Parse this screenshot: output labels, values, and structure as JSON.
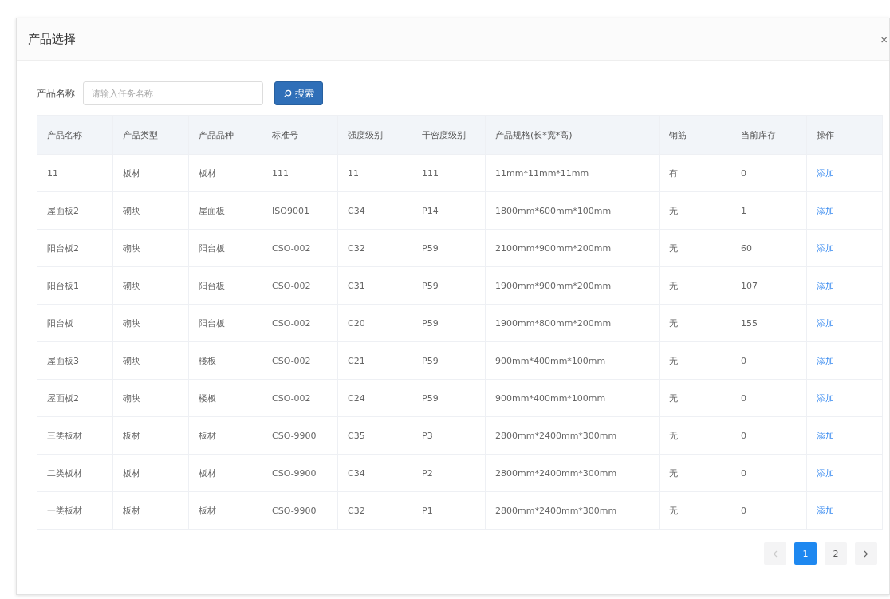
{
  "dialog": {
    "title": "产品选择",
    "close": "×"
  },
  "search": {
    "label": "产品名称",
    "placeholder": "请输入任务名称",
    "button": "搜索"
  },
  "table": {
    "columns": [
      "产品名称",
      "产品类型",
      "产品品种",
      "标准号",
      "强度级别",
      "干密度级别",
      "产品规格(长*宽*高)",
      "钢筋",
      "当前库存",
      "操作"
    ],
    "rows": [
      {
        "cells": [
          "11",
          "板材",
          "板材",
          "111",
          "11",
          "111",
          "11mm*11mm*11mm",
          "有",
          "0"
        ],
        "action": "添加"
      },
      {
        "cells": [
          "屋面板2",
          "砌块",
          "屋面板",
          "ISO9001",
          "C34",
          "P14",
          "1800mm*600mm*100mm",
          "无",
          "1"
        ],
        "action": "添加"
      },
      {
        "cells": [
          "阳台板2",
          "砌块",
          "阳台板",
          "CSO-002",
          "C32",
          "P59",
          "2100mm*900mm*200mm",
          "无",
          "60"
        ],
        "action": "添加"
      },
      {
        "cells": [
          "阳台板1",
          "砌块",
          "阳台板",
          "CSO-002",
          "C31",
          "P59",
          "1900mm*900mm*200mm",
          "无",
          "107"
        ],
        "action": "添加"
      },
      {
        "cells": [
          "阳台板",
          "砌块",
          "阳台板",
          "CSO-002",
          "C20",
          "P59",
          "1900mm*800mm*200mm",
          "无",
          "155"
        ],
        "action": "添加"
      },
      {
        "cells": [
          "屋面板3",
          "砌块",
          "楼板",
          "CSO-002",
          "C21",
          "P59",
          "900mm*400mm*100mm",
          "无",
          "0"
        ],
        "action": "添加"
      },
      {
        "cells": [
          "屋面板2",
          "砌块",
          "楼板",
          "CSO-002",
          "C24",
          "P59",
          "900mm*400mm*100mm",
          "无",
          "0"
        ],
        "action": "添加"
      },
      {
        "cells": [
          "三类板材",
          "板材",
          "板材",
          "CSO-9900",
          "C35",
          "P3",
          "2800mm*2400mm*300mm",
          "无",
          "0"
        ],
        "action": "添加"
      },
      {
        "cells": [
          "二类板材",
          "板材",
          "板材",
          "CSO-9900",
          "C34",
          "P2",
          "2800mm*2400mm*300mm",
          "无",
          "0"
        ],
        "action": "添加"
      },
      {
        "cells": [
          "一类板材",
          "板材",
          "板材",
          "CSO-9900",
          "C32",
          "P1",
          "2800mm*2400mm*300mm",
          "无",
          "0"
        ],
        "action": "添加"
      }
    ]
  },
  "pagination": {
    "prev_disabled": true,
    "next_disabled": false,
    "pages": [
      {
        "label": "1",
        "selected": true
      },
      {
        "label": "2",
        "selected": false
      }
    ]
  }
}
